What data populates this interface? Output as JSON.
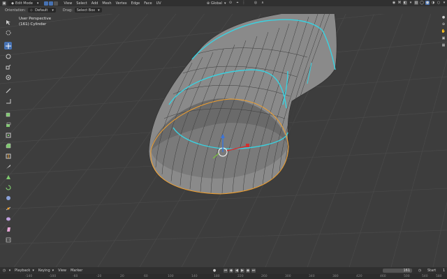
{
  "header": {
    "mode": "Edit Mode",
    "menus": [
      "View",
      "Select",
      "Add",
      "Mesh",
      "Vertex",
      "Edge",
      "Face",
      "UV"
    ],
    "transform_orientation": "Global"
  },
  "tool_settings": {
    "orientation_label": "Orientation:",
    "orientation_value": "Default",
    "drag_label": "Drag:",
    "drag_value": "Select Box"
  },
  "viewport": {
    "view_name": "User Perspective",
    "object_info": "(161) Cylinder"
  },
  "toolbar": {
    "tools": [
      "cursor-select-icon",
      "cursor-3d-icon",
      "move-icon",
      "rotate-icon",
      "scale-icon",
      "transform-icon",
      "annotate-icon",
      "measure-icon",
      "add-cube-icon",
      "extrude-icon",
      "inset-icon",
      "bevel-icon",
      "loop-cut-icon",
      "knife-icon",
      "poly-build-icon",
      "spin-icon",
      "smooth-icon",
      "edge-slide-icon",
      "shrink-fatten-icon",
      "shear-icon",
      "rip-icon"
    ]
  },
  "timeline": {
    "menus": [
      "Playback",
      "Keying",
      "View",
      "Marker"
    ],
    "current_frame": "161",
    "start_label": "Start",
    "start_value": "1",
    "ruler_ticks": [
      "-140",
      "-100",
      "-60",
      "-20",
      "20",
      "60",
      "100",
      "140",
      "180",
      "220",
      "260",
      "300",
      "340",
      "380",
      "420",
      "460",
      "500",
      "540",
      "580"
    ]
  },
  "colors": {
    "accent": "#4772b3",
    "selected_loop": "#3ad1e0",
    "boundary": "#f0a030",
    "mesh": "#8c8c8c",
    "background": "#3d3d3d"
  }
}
